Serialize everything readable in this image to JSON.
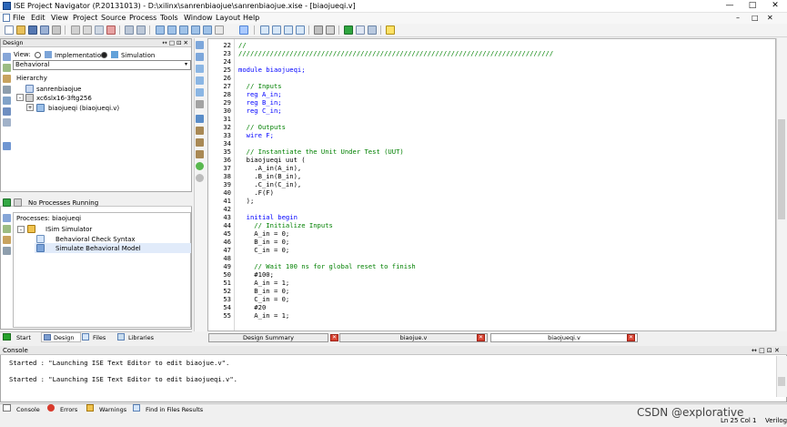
{
  "window": {
    "title": "ISE Project Navigator (P.20131013) - D:\\xilinx\\sanrenbiaojue\\sanrenbiaojue.xise - [biaojueqi.v]",
    "min_label": "—",
    "max_label": "□",
    "close_label": "✕",
    "inner_min": "–",
    "inner_max": "□",
    "inner_close": "✕"
  },
  "menu": [
    "File",
    "Edit",
    "View",
    "Project",
    "Source",
    "Process",
    "Tools",
    "Window",
    "Layout",
    "Help"
  ],
  "design_panel": {
    "title": "Design",
    "header_controls": "↔ □ ⊡ ✕",
    "view_label": "View:",
    "impl_label": "Implementation",
    "sim_label": "Simulation",
    "behavioral": "Behavioral",
    "hierarchy_label": "Hierarchy",
    "tree": [
      "sanrenbiaojue",
      "xc6slx16-3ftg256",
      "biaojueqi (biaojueqi.v)"
    ]
  },
  "process_panel": {
    "status": "No Processes Running",
    "processes_label": "Processes: biaojueqi",
    "items": [
      "ISim Simulator",
      "Behavioral Check Syntax",
      "Simulate Behavioral Model"
    ]
  },
  "left_tabs": [
    "Start",
    "Design",
    "Files",
    "Libraries"
  ],
  "editor": {
    "lines": [
      {
        "n": "22",
        "text": "//",
        "cls": "c-comment"
      },
      {
        "n": "23",
        "text": "////////////////////////////////////////////////////////////////////////////////",
        "cls": "c-comment"
      },
      {
        "n": "24",
        "text": "",
        "cls": "c-text"
      },
      {
        "n": "25",
        "text": "module biaojueqi;",
        "cls": "c-kw"
      },
      {
        "n": "26",
        "text": "",
        "cls": "c-text"
      },
      {
        "n": "27",
        "text": "  // Inputs",
        "cls": "c-comment"
      },
      {
        "n": "28",
        "text": "  reg A_in;",
        "cls": "c-kw"
      },
      {
        "n": "29",
        "text": "  reg B_in;",
        "cls": "c-kw"
      },
      {
        "n": "30",
        "text": "  reg C_in;",
        "cls": "c-kw"
      },
      {
        "n": "31",
        "text": "",
        "cls": "c-text"
      },
      {
        "n": "32",
        "text": "  // Outputs",
        "cls": "c-comment"
      },
      {
        "n": "33",
        "text": "  wire F;",
        "cls": "c-kw"
      },
      {
        "n": "34",
        "text": "",
        "cls": "c-text"
      },
      {
        "n": "35",
        "text": "  // Instantiate the Unit Under Test (UUT)",
        "cls": "c-comment"
      },
      {
        "n": "36",
        "text": "  biaojueqi uut (",
        "cls": "c-text"
      },
      {
        "n": "37",
        "text": "    .A_in(A_in),",
        "cls": "c-text"
      },
      {
        "n": "38",
        "text": "    .B_in(B_in),",
        "cls": "c-text"
      },
      {
        "n": "39",
        "text": "    .C_in(C_in),",
        "cls": "c-text"
      },
      {
        "n": "40",
        "text": "    .F(F)",
        "cls": "c-text"
      },
      {
        "n": "41",
        "text": "  );",
        "cls": "c-text"
      },
      {
        "n": "42",
        "text": "",
        "cls": "c-text"
      },
      {
        "n": "43",
        "text": "  initial begin",
        "cls": "c-kw"
      },
      {
        "n": "44",
        "text": "    // Initialize Inputs",
        "cls": "c-comment"
      },
      {
        "n": "45",
        "text": "    A_in = 0;",
        "cls": "c-text"
      },
      {
        "n": "46",
        "text": "    B_in = 0;",
        "cls": "c-text"
      },
      {
        "n": "47",
        "text": "    C_in = 0;",
        "cls": "c-text"
      },
      {
        "n": "48",
        "text": "",
        "cls": "c-text"
      },
      {
        "n": "49",
        "text": "    // Wait 100 ns for global reset to finish",
        "cls": "c-comment"
      },
      {
        "n": "50",
        "text": "    #100;",
        "cls": "c-text"
      },
      {
        "n": "51",
        "text": "    A_in = 1;",
        "cls": "c-text"
      },
      {
        "n": "52",
        "text": "    B_in = 0;",
        "cls": "c-text"
      },
      {
        "n": "53",
        "text": "    C_in = 0;",
        "cls": "c-text"
      },
      {
        "n": "54",
        "text": "    #20",
        "cls": "c-text"
      },
      {
        "n": "55",
        "text": "    A_in = 1;",
        "cls": "c-text"
      }
    ]
  },
  "editor_tabs": [
    "Design Summary",
    "biaojue.v",
    "biaojueqi.v"
  ],
  "console": {
    "title": "Console",
    "lines": [
      "Started : \"Launching ISE Text Editor to edit biaojue.v\".",
      "Started : \"Launching ISE Text Editor to edit biaojueqi.v\"."
    ]
  },
  "bottom_tabs": [
    "Console",
    "Errors",
    "Warnings",
    "Find in Files Results"
  ],
  "status": {
    "position": "Ln 25 Col 1",
    "language": "Verilog",
    "watermark": "CSDN @explorative"
  },
  "colors": {
    "keyword": "#0000ff",
    "comment": "#008000",
    "selection": "#ddeeff"
  }
}
